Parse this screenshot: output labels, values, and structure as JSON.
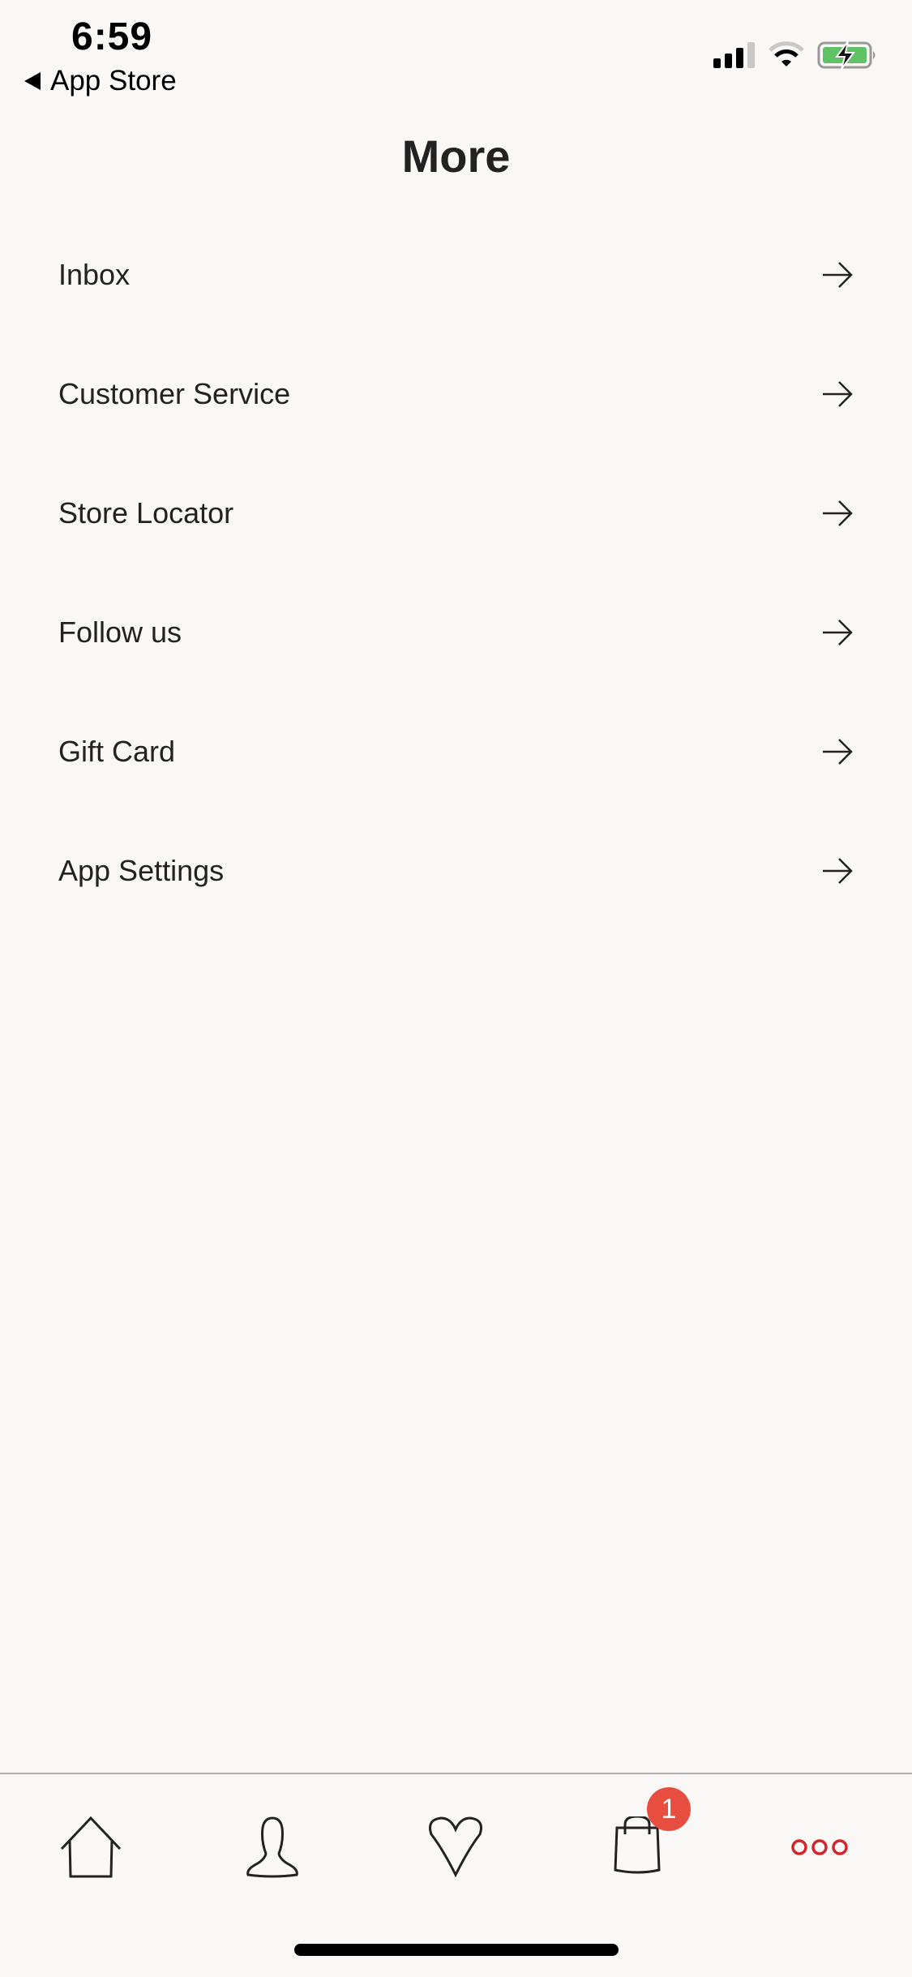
{
  "status_bar": {
    "time": "6:59",
    "back_label": "App Store",
    "battery_color": "#5fc366"
  },
  "header": {
    "title": "More"
  },
  "menu": {
    "items": [
      {
        "label": "Inbox"
      },
      {
        "label": "Customer Service"
      },
      {
        "label": "Store Locator"
      },
      {
        "label": "Follow us"
      },
      {
        "label": "Gift Card"
      },
      {
        "label": "App Settings"
      }
    ]
  },
  "tabbar": {
    "tabs": [
      {
        "icon": "home-icon"
      },
      {
        "icon": "profile-icon"
      },
      {
        "icon": "heart-icon"
      },
      {
        "icon": "shopping-bag-icon",
        "badge": "1"
      },
      {
        "icon": "more-icon",
        "active": true
      }
    ],
    "accent_color": "#d0262c",
    "badge_color": "#e84e3f"
  }
}
